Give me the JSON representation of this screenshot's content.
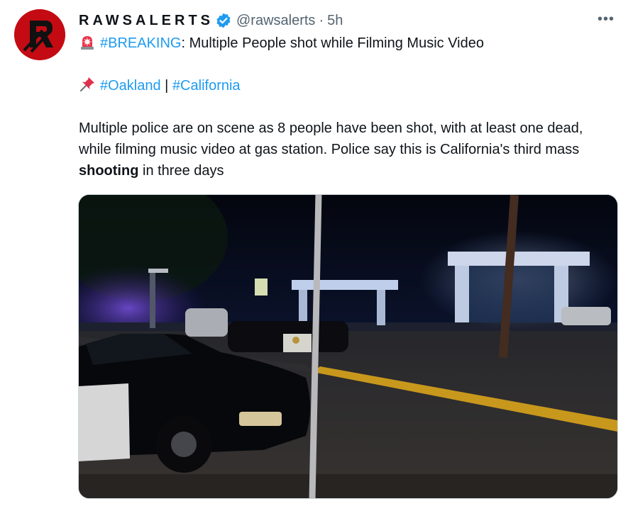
{
  "tweet": {
    "author": {
      "display_name": "RAWSALERTS",
      "handle": "@rawsalerts",
      "separator": "·",
      "time": "5h",
      "verified": true,
      "avatar_icon": "raws-logo"
    },
    "more_label": "•••",
    "line1": {
      "emoji_icon": "police-siren-icon",
      "hashtag": "#BREAKING",
      "text": ": Multiple People shot while Filming Music Video"
    },
    "line2": {
      "emoji_icon": "pushpin-icon",
      "hashtag1": "#Oakland",
      "separator": " | ",
      "hashtag2": "#California"
    },
    "body": {
      "text_before": "Multiple police are on scene as 8 people have been shot, with at least one dead, while filming music video at gas station. Police say this is California's third mass ",
      "bold": "shooting",
      "text_after": " in three days"
    },
    "media": {
      "type": "video-still",
      "description_icon": "night-scene-police-car-gas-station"
    }
  },
  "colors": {
    "link": "#1d9bf0",
    "text": "#0f1419",
    "secondary": "#536471",
    "avatar_bg": "#c40b13",
    "verified": "#1d9bf0"
  }
}
